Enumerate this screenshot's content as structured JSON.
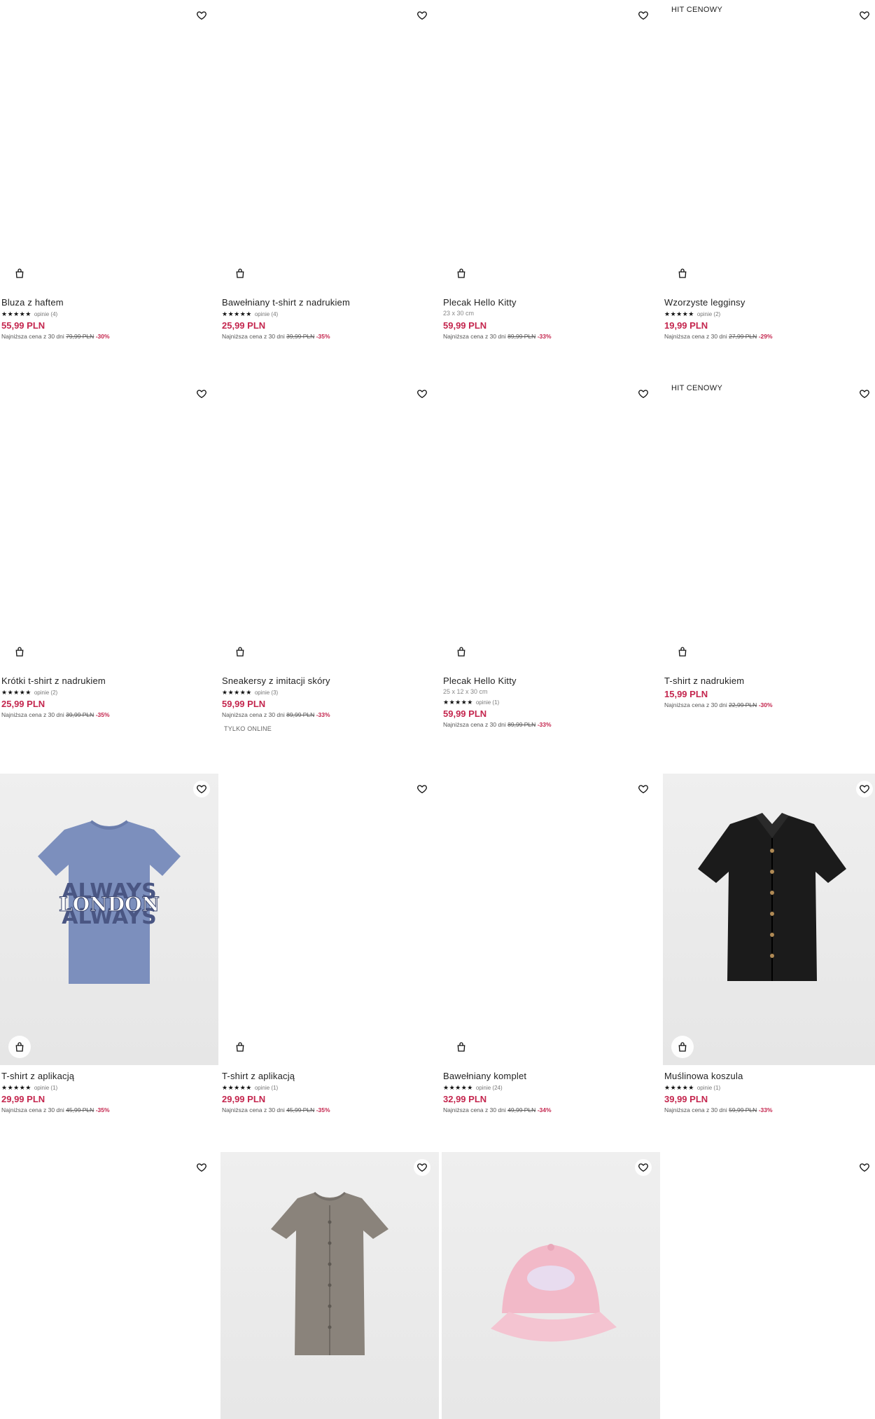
{
  "colors": {
    "price": "#c4264e",
    "text": "#222222",
    "muted": "#777777"
  },
  "icons": {
    "favorite": "heart-outline-icon",
    "cart": "shopping-bag-icon"
  },
  "products": [
    {
      "name": "Bluza z haftem",
      "sub": "",
      "rating": 5,
      "opinions": "opinie (4)",
      "price": "55,99 PLN",
      "lowest_label": "Najniższa cena z 30 dni",
      "old_price": "79,99 PLN",
      "discount": "-30%",
      "badge": "",
      "extra": ""
    },
    {
      "name": "Bawełniany t-shirt z nadrukiem",
      "sub": "",
      "rating": 5,
      "opinions": "opinie (4)",
      "price": "25,99 PLN",
      "lowest_label": "Najniższa cena z 30 dni",
      "old_price": "39,99 PLN",
      "discount": "-35%",
      "badge": "",
      "extra": ""
    },
    {
      "name": "Plecak Hello Kitty",
      "sub": "23 x 30 cm",
      "rating": 0,
      "opinions": "",
      "price": "59,99 PLN",
      "lowest_label": "Najniższa cena z 30 dni",
      "old_price": "89,99 PLN",
      "discount": "-33%",
      "badge": "",
      "extra": ""
    },
    {
      "name": "Wzorzyste legginsy",
      "sub": "",
      "rating": 5,
      "opinions": "opinie (2)",
      "price": "19,99 PLN",
      "lowest_label": "Najniższa cena z 30 dni",
      "old_price": "27,99 PLN",
      "discount": "-29%",
      "badge": "HIT CENOWY",
      "extra": ""
    },
    {
      "name": "Krótki t-shirt z nadrukiem",
      "sub": "",
      "rating": 5,
      "opinions": "opinie (2)",
      "price": "25,99 PLN",
      "lowest_label": "Najniższa cena z 30 dni",
      "old_price": "39,99 PLN",
      "discount": "-35%",
      "badge": "",
      "extra": ""
    },
    {
      "name": "Sneakersy z imitacji skóry",
      "sub": "",
      "rating": 5,
      "opinions": "opinie (3)",
      "price": "59,99 PLN",
      "lowest_label": "Najniższa cena z 30 dni",
      "old_price": "89,99 PLN",
      "discount": "-33%",
      "badge": "",
      "extra": "TYLKO ONLINE"
    },
    {
      "name": "Plecak Hello Kitty",
      "sub": "25 x 12 x 30 cm",
      "rating": 5,
      "opinions": "opinie (1)",
      "price": "59,99 PLN",
      "lowest_label": "Najniższa cena z 30 dni",
      "old_price": "89,99 PLN",
      "discount": "-33%",
      "badge": "",
      "extra": ""
    },
    {
      "name": "T-shirt z nadrukiem",
      "sub": "",
      "rating": 0,
      "opinions": "",
      "price": "15,99 PLN",
      "lowest_label": "Najniższa cena z 30 dni",
      "old_price": "22,99 PLN",
      "discount": "-30%",
      "badge": "HIT CENOWY",
      "extra": ""
    },
    {
      "name": "T-shirt z aplikacją",
      "sub": "",
      "rating": 5,
      "opinions": "opinie (1)",
      "price": "29,99 PLN",
      "lowest_label": "Najniższa cena z 30 dni",
      "old_price": "45,99 PLN",
      "discount": "-35%",
      "badge": "",
      "extra": "",
      "image": "tshirt-london"
    },
    {
      "name": "T-shirt z aplikacją",
      "sub": "",
      "rating": 5,
      "opinions": "opinie (1)",
      "price": "29,99 PLN",
      "lowest_label": "Najniższa cena z 30 dni",
      "old_price": "45,99 PLN",
      "discount": "-35%",
      "badge": "",
      "extra": ""
    },
    {
      "name": "Bawełniany komplet",
      "sub": "",
      "rating": 5,
      "opinions": "opinie (24)",
      "price": "32,99 PLN",
      "lowest_label": "Najniższa cena z 30 dni",
      "old_price": "49,99 PLN",
      "discount": "-34%",
      "badge": "",
      "extra": ""
    },
    {
      "name": "Muślinowa koszula",
      "sub": "",
      "rating": 5,
      "opinions": "opinie (1)",
      "price": "39,99 PLN",
      "lowest_label": "Najniższa cena z 30 dni",
      "old_price": "59,99 PLN",
      "discount": "-33%",
      "badge": "",
      "extra": "",
      "image": "black-shirt"
    },
    {
      "name": "",
      "image": "blank"
    },
    {
      "name": "",
      "image": "grey-top"
    },
    {
      "name": "",
      "image": "pink-cap"
    },
    {
      "name": "",
      "image": "blank"
    }
  ],
  "london_print": "LONDON",
  "always_print": "ALWAYS"
}
